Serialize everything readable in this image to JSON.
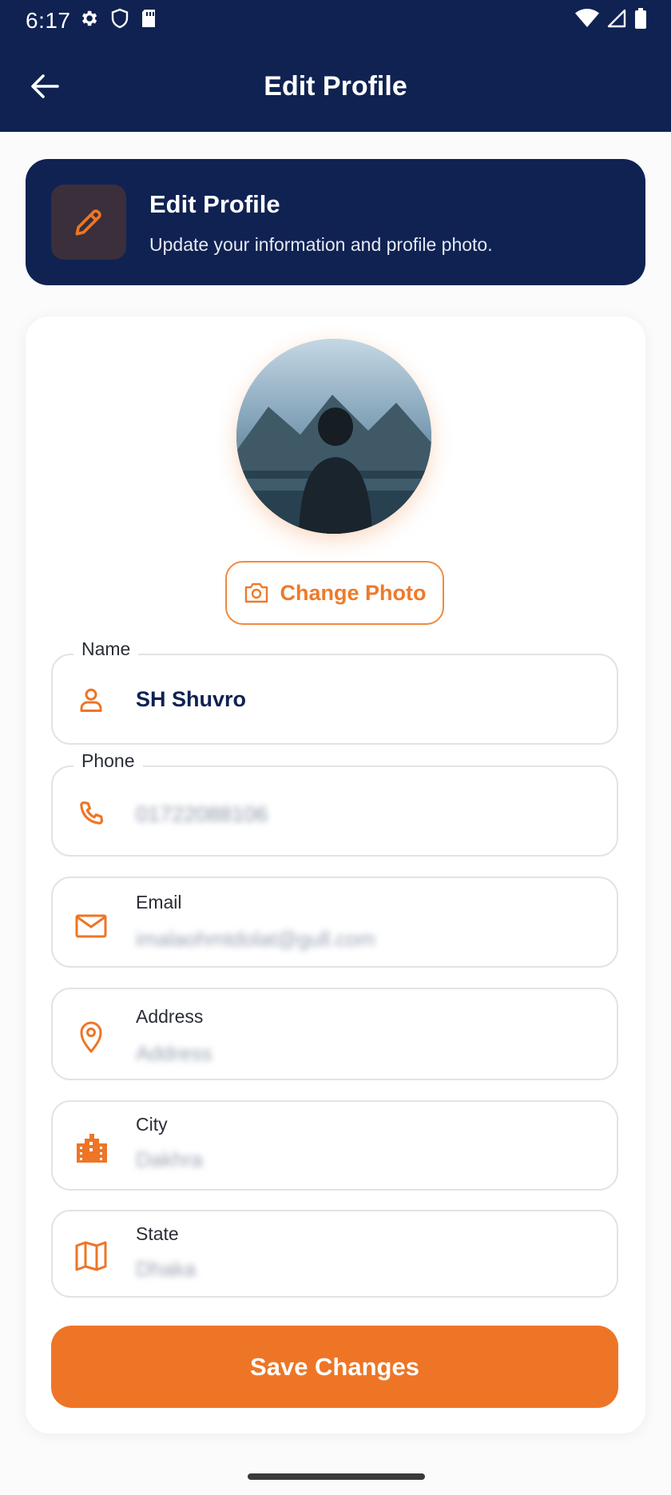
{
  "status_bar": {
    "time": "6:17"
  },
  "app_bar": {
    "title": "Edit Profile"
  },
  "header_card": {
    "title": "Edit Profile",
    "subtitle": "Update your information and profile photo."
  },
  "avatar": {
    "change_photo_label": "Change Photo"
  },
  "fields": {
    "name": {
      "label": "Name",
      "value": "SH Shuvro",
      "icon": "person-icon"
    },
    "phone": {
      "label": "Phone",
      "value": "01722088106",
      "icon": "phone-icon"
    },
    "email": {
      "label": "Email",
      "placeholder": "imalaohmtdolat@gull.com",
      "icon": "mail-icon"
    },
    "address": {
      "label": "Address",
      "placeholder": "Address",
      "icon": "location-pin-icon"
    },
    "city": {
      "label": "City",
      "placeholder": "Dakhra",
      "icon": "city-icon"
    },
    "state": {
      "label": "State",
      "placeholder": "Dhaka",
      "icon": "map-icon"
    }
  },
  "actions": {
    "save_label": "Save Changes"
  },
  "colors": {
    "navy": "#0f2252",
    "orange": "#ee7526",
    "border": "#e1e3e8"
  }
}
